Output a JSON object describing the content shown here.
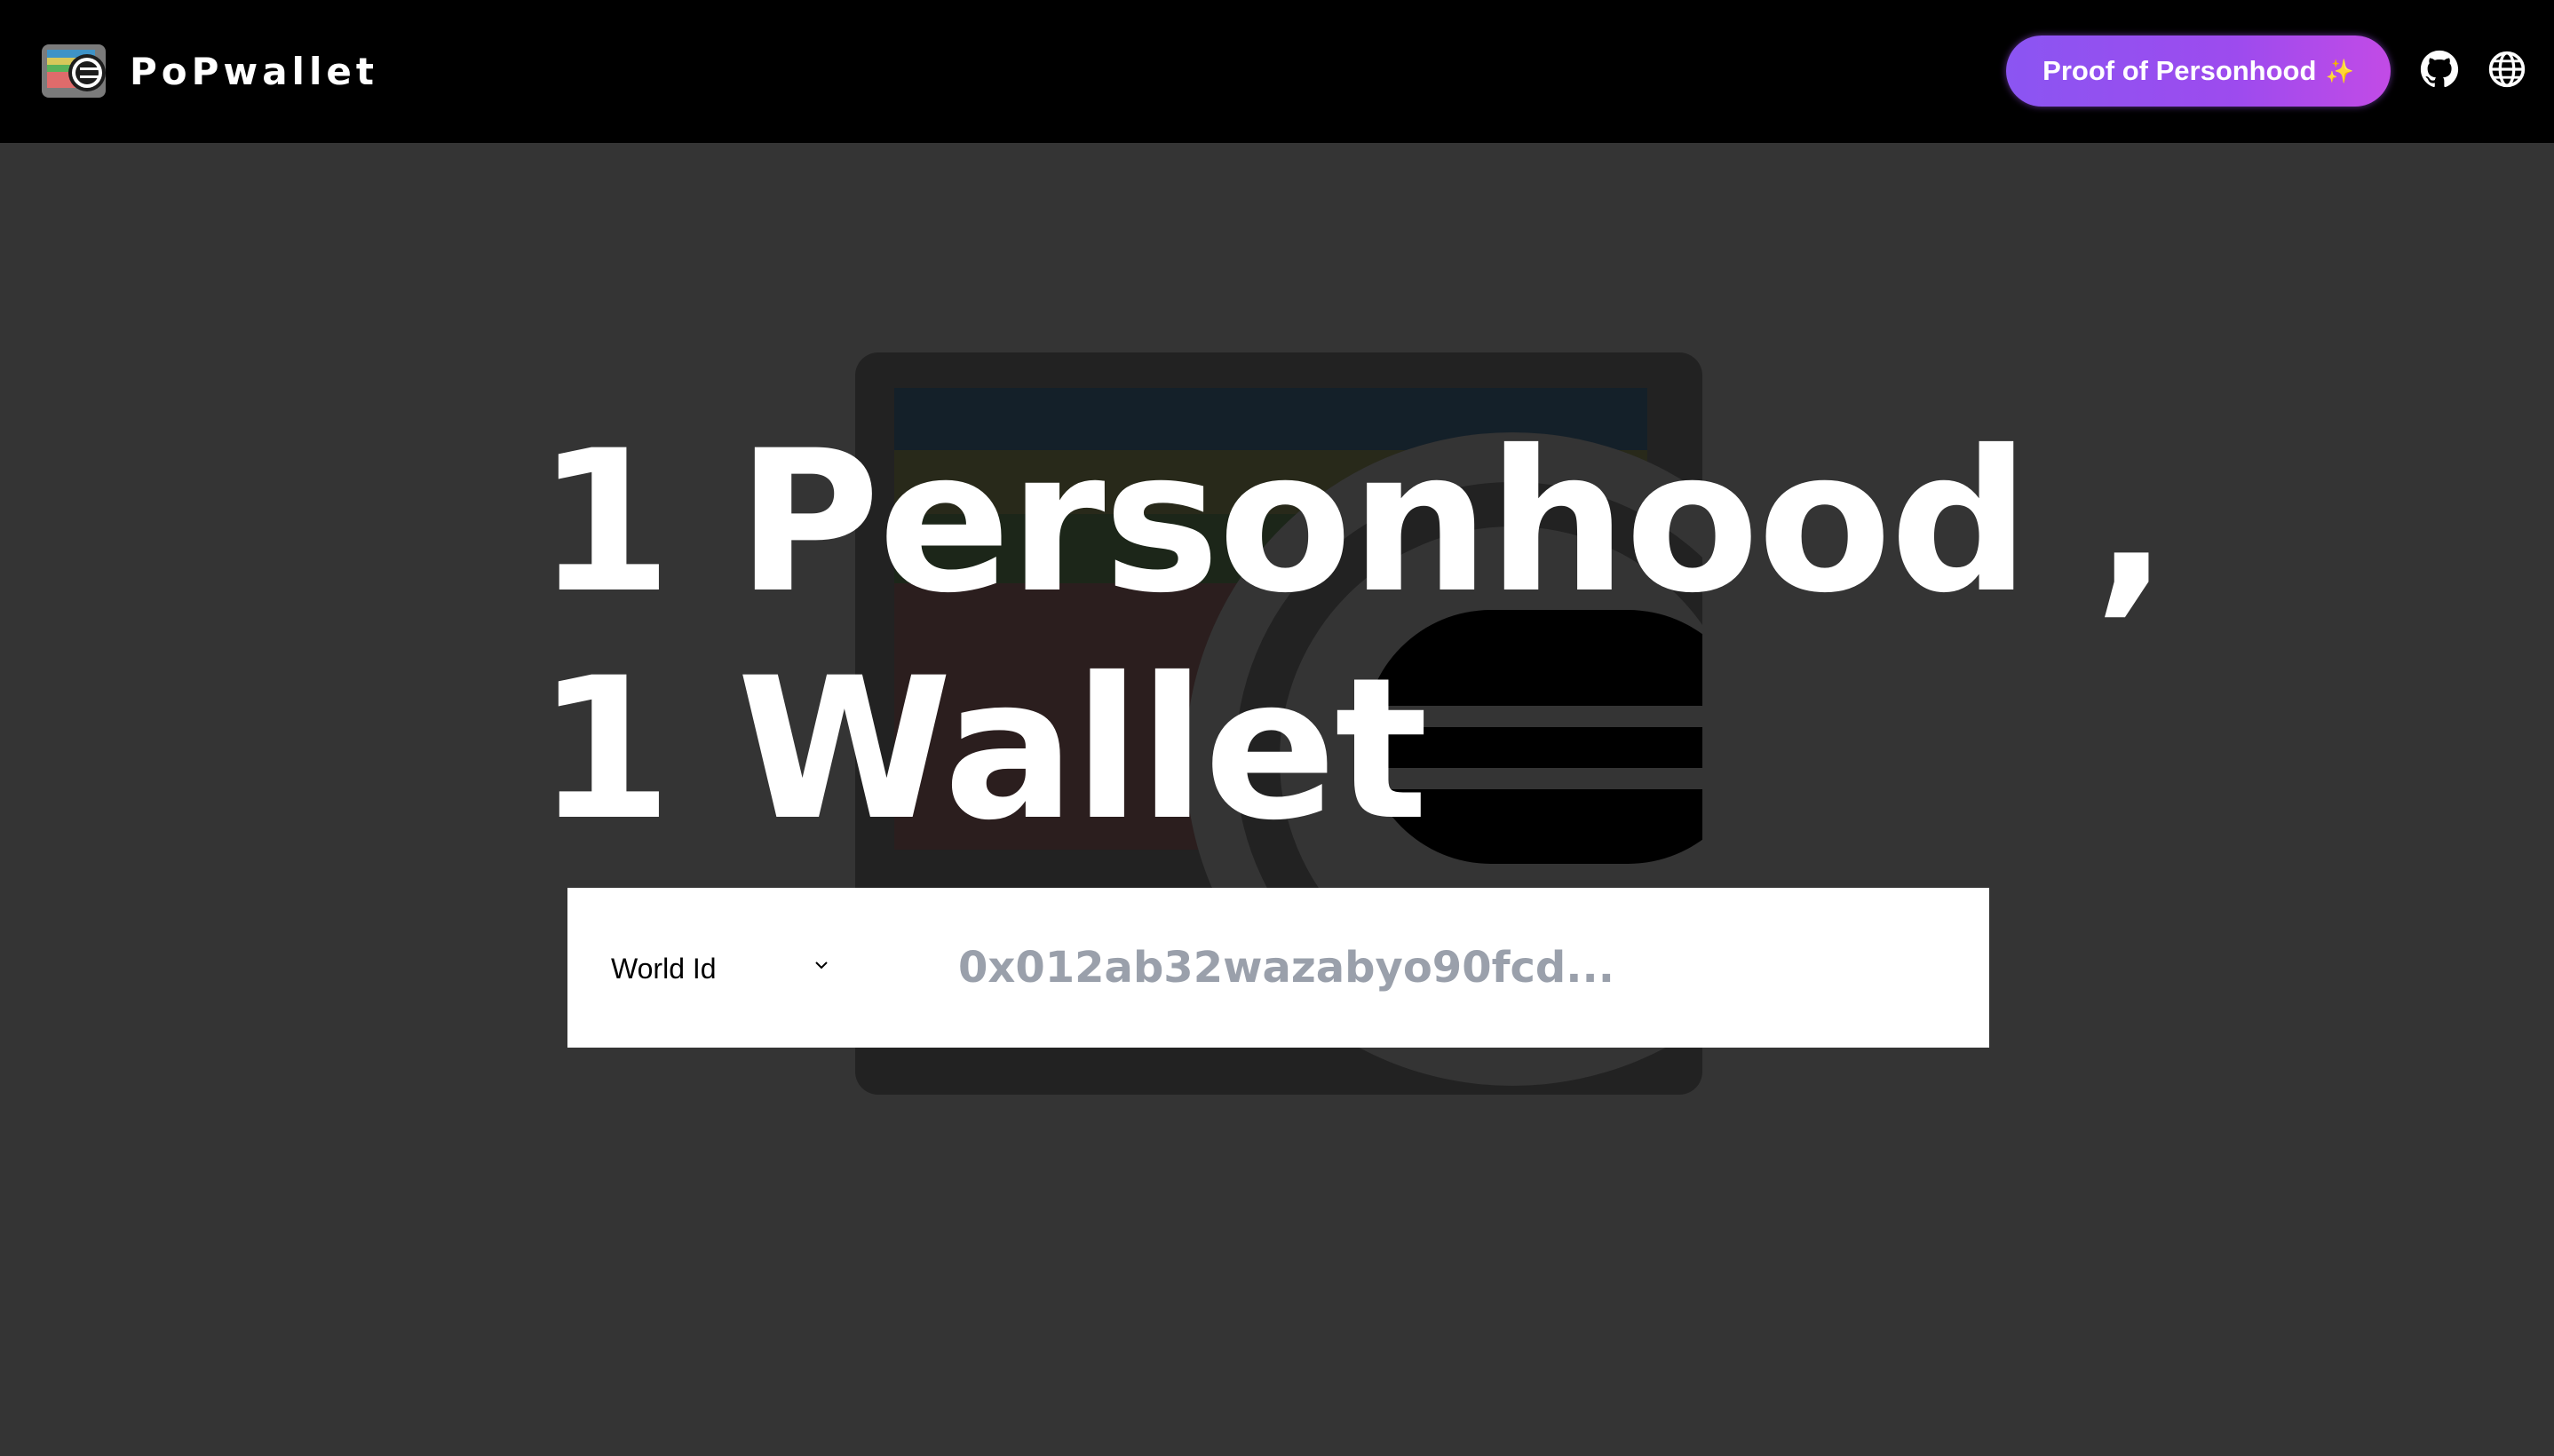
{
  "header": {
    "brand_name": "PoPwallet",
    "logo_icon": "popwallet-logo-icon",
    "cta_label": "Proof of Personhood",
    "cta_sparkle": "✨",
    "github_icon": "github-icon",
    "globe_icon": "globe-icon"
  },
  "hero": {
    "line1": "1 Personhood ,",
    "line2": "1 Wallet",
    "background_icon": "wallet-illustration-icon"
  },
  "search": {
    "id_type_selected": "World Id",
    "address_placeholder": "0x012ab32wazabyo90fcd..."
  },
  "colors": {
    "page_background": "#343434",
    "header_background": "#000000",
    "cta_gradient_start": "#8b55f2",
    "cta_gradient_end": "#c24be6",
    "placeholder_text": "#9aa0ab"
  }
}
